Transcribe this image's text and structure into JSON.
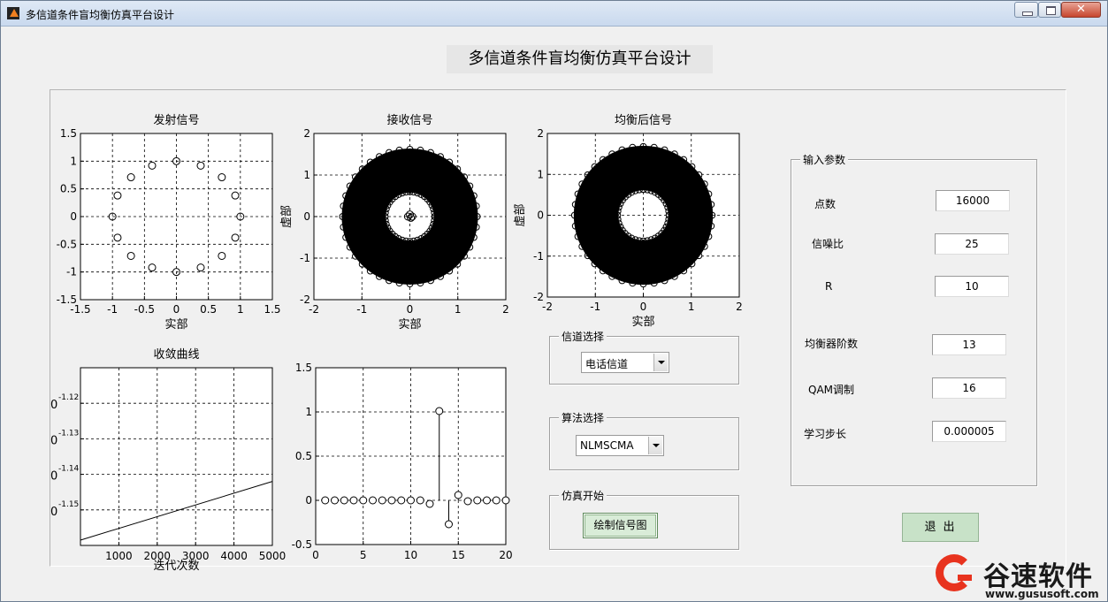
{
  "window": {
    "title": "多信道条件盲均衡仿真平台设计"
  },
  "main_title": "多信道条件盲均衡仿真平台设计",
  "channel_group": {
    "title": "信道选择",
    "selected": "电话信道"
  },
  "algo_group": {
    "title": "算法选择",
    "selected": "NLMSCMA"
  },
  "sim_group": {
    "title": "仿真开始",
    "button": "绘制信号图"
  },
  "params": {
    "title": "输入参数",
    "fields": [
      {
        "label": "点数",
        "value": "16000"
      },
      {
        "label": "信噪比",
        "value": "25"
      },
      {
        "label": "R",
        "value": "10"
      },
      {
        "label": "均衡器阶数",
        "value": "13"
      },
      {
        "label": "QAM调制",
        "value": "16"
      },
      {
        "label": "学习步长",
        "value": "0.000005"
      }
    ]
  },
  "exit_button": "退出",
  "watermark": {
    "text": "谷速软件",
    "url": "www.gususoft.com"
  },
  "chart_data": [
    {
      "type": "scatter",
      "title": "发射信号",
      "xlabel": "实部",
      "ylabel": "",
      "xlim": [
        -1.5,
        1.5
      ],
      "ylim": [
        -1.5,
        1.5
      ],
      "xticks": [
        "-1.5",
        "-1",
        "-0.5",
        "0",
        "0.5",
        "1",
        "1.5"
      ],
      "yticks": [
        "-1.5",
        "-1",
        "-0.5",
        "0",
        "0.5",
        "1",
        "1.5"
      ],
      "grid": true,
      "points": [
        [
          0,
          1
        ],
        [
          0.38,
          0.92
        ],
        [
          0.71,
          0.71
        ],
        [
          0.92,
          0.38
        ],
        [
          1,
          0
        ],
        [
          0.92,
          -0.38
        ],
        [
          0.71,
          -0.71
        ],
        [
          0.38,
          -0.92
        ],
        [
          0,
          -1
        ],
        [
          -0.38,
          -0.92
        ],
        [
          -0.71,
          -0.71
        ],
        [
          -0.92,
          -0.38
        ],
        [
          -1,
          0
        ],
        [
          -0.92,
          0.38
        ],
        [
          -0.71,
          0.71
        ],
        [
          -0.38,
          0.92
        ]
      ]
    },
    {
      "type": "scatter",
      "title": "接收信号",
      "xlabel": "实部",
      "ylabel": "虚部",
      "xlim": [
        -2,
        2
      ],
      "ylim": [
        -2,
        2
      ],
      "xticks": [
        "-2",
        "-1",
        "0",
        "1",
        "2"
      ],
      "yticks": [
        "-2",
        "-1",
        "0",
        "1",
        "2"
      ],
      "grid": true,
      "ring": {
        "inner": 0.5,
        "outer": 1.42
      },
      "center_points": [
        [
          0,
          0.05
        ],
        [
          0.05,
          0
        ],
        [
          -0.04,
          0
        ],
        [
          0.02,
          -0.03
        ]
      ]
    },
    {
      "type": "scatter",
      "title": "均衡后信号",
      "xlabel": "实部",
      "ylabel": "虚部",
      "xlim": [
        -2,
        2
      ],
      "ylim": [
        -2,
        2
      ],
      "xticks": [
        "-2",
        "-1",
        "0",
        "1",
        "2"
      ],
      "yticks": [
        "-2",
        "-1",
        "0",
        "1",
        "2"
      ],
      "grid": true,
      "ring": {
        "inner": 0.52,
        "outer": 1.45
      }
    },
    {
      "type": "line",
      "title": "收敛曲线",
      "xlabel": "迭代次数",
      "ylabel": "",
      "xlim": [
        0,
        5000
      ],
      "xticks": [
        "1000",
        "2000",
        "3000",
        "4000",
        "5000"
      ],
      "ytick_labels": [
        "0",
        "0",
        "0",
        "0"
      ],
      "ytick_exponents": [
        "-1.12",
        "-1.13",
        "-1.14",
        "-1.15"
      ],
      "grid": true,
      "x": [
        0,
        5000
      ],
      "y_frac": [
        0.03,
        0.36
      ]
    },
    {
      "type": "stem",
      "title": "",
      "xlim": [
        0,
        20
      ],
      "ylim": [
        -0.5,
        1.5
      ],
      "xticks": [
        "0",
        "5",
        "10",
        "15",
        "20"
      ],
      "yticks": [
        "-0.5",
        "0",
        "0.5",
        "1",
        "1.5"
      ],
      "grid": true,
      "x": [
        1,
        2,
        3,
        4,
        5,
        6,
        7,
        8,
        9,
        10,
        11,
        12,
        13,
        14,
        15,
        16,
        17,
        18,
        19,
        20
      ],
      "y": [
        0,
        0,
        0,
        0,
        0,
        0,
        0,
        0,
        0,
        0,
        0,
        -0.04,
        1.01,
        -0.27,
        0.06,
        -0.01,
        0,
        0,
        0,
        0
      ]
    }
  ]
}
